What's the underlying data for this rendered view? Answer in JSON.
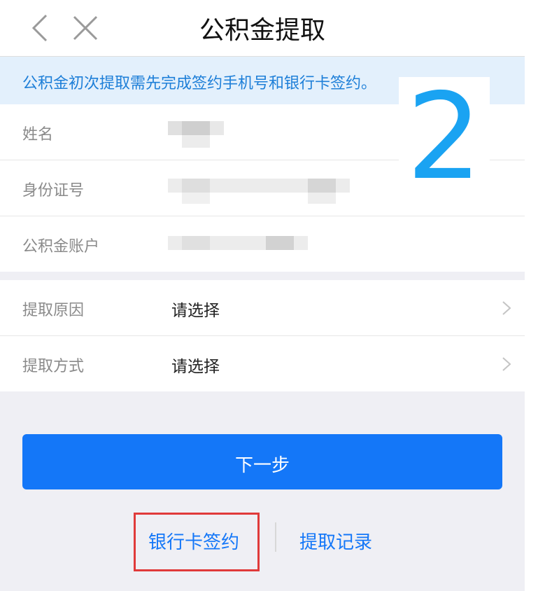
{
  "nav": {
    "title": "公积金提取"
  },
  "notice": {
    "text": "公积金初次提取需先完成签约手机号和银行卡签约。"
  },
  "info": [
    {
      "label": "姓名"
    },
    {
      "label": "身份证号"
    },
    {
      "label": "公积金账户"
    }
  ],
  "form": [
    {
      "label": "提取原因",
      "value": "请选择"
    },
    {
      "label": "提取方式",
      "value": "请选择"
    }
  ],
  "annotation": {
    "step": "2"
  },
  "buttons": {
    "next": "下一步"
  },
  "links": {
    "bank_sign": "银行卡签约",
    "records": "提取记录"
  },
  "colors": {
    "primary": "#1477f8",
    "notice_bg": "#e3f0fc",
    "highlight": "#e03a3a"
  },
  "icons": {
    "back": "chevron-left-icon",
    "close": "close-icon",
    "row_arrow": "chevron-right-icon"
  }
}
